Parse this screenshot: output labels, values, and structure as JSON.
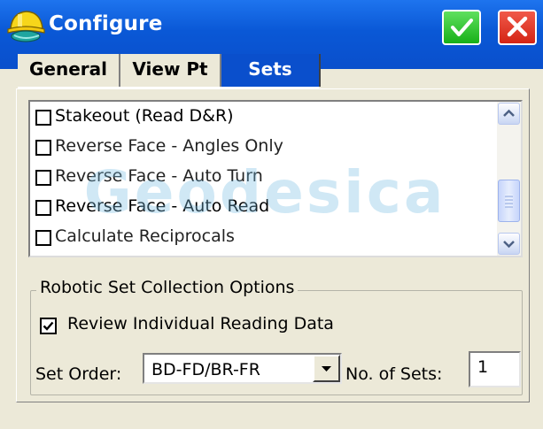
{
  "window": {
    "title": "Configure",
    "ok_icon": "checkmark-icon",
    "close_icon": "close-icon",
    "ok_color": "#22c022",
    "close_color": "#e0301e",
    "titlebar_color": "#0a4fcc"
  },
  "tabs": [
    {
      "label": "General",
      "active": false
    },
    {
      "label": "View Pt",
      "active": false
    },
    {
      "label": "Sets",
      "active": true
    }
  ],
  "options_list": {
    "items": [
      {
        "label": "Stakeout (Read D&R)",
        "checked": false
      },
      {
        "label": "Reverse Face - Angles Only",
        "checked": false
      },
      {
        "label": "Reverse Face - Auto Turn",
        "checked": false
      },
      {
        "label": "Reverse Face - Auto Read",
        "checked": false
      },
      {
        "label": "Calculate Reciprocals",
        "checked": false
      }
    ],
    "watermark": "Geodesica"
  },
  "robotic_group": {
    "title": "Robotic Set Collection Options",
    "review_label": "Review Individual Reading Data",
    "review_checked": true,
    "set_order_label": "Set Order:",
    "set_order_value": "BD-FD/BR-FR",
    "num_sets_label": "No. of Sets:",
    "num_sets_value": "1"
  }
}
